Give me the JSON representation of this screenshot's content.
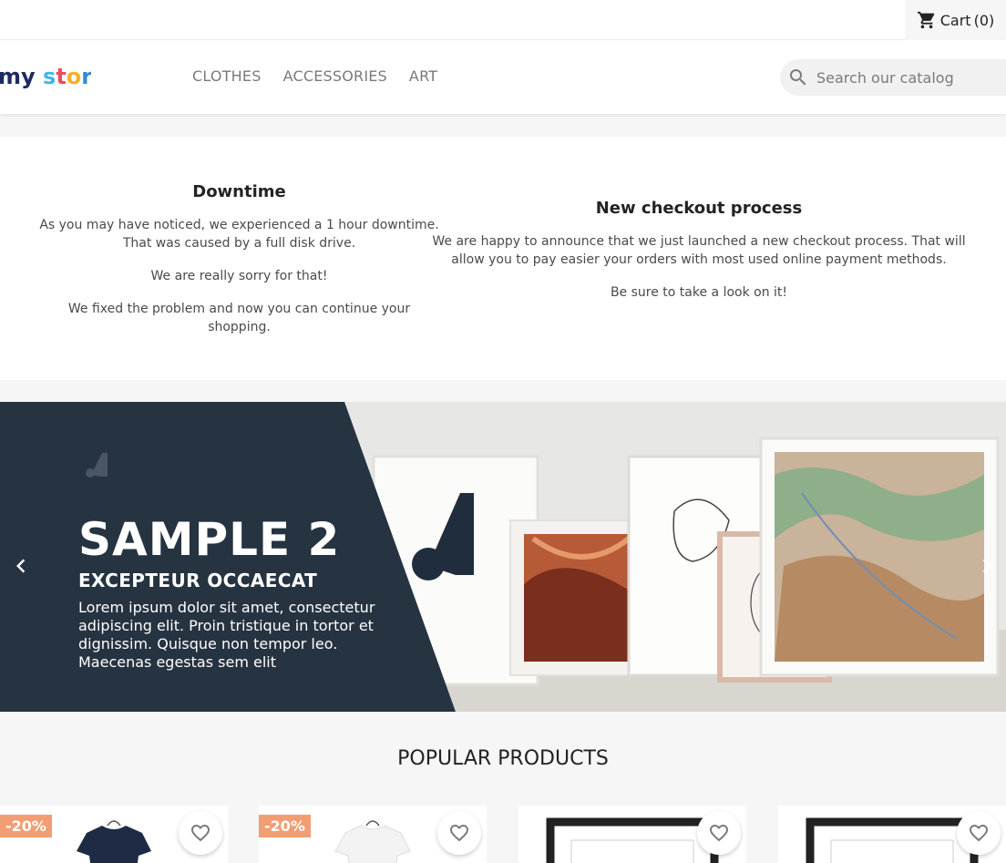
{
  "topbar": {
    "cart_label": "Cart",
    "cart_count": "(0)"
  },
  "header": {
    "logo_alt": "my store",
    "menu": [
      {
        "label": "CLOTHES"
      },
      {
        "label": "ACCESSORIES"
      },
      {
        "label": "ART"
      }
    ],
    "search_placeholder": "Search our catalog"
  },
  "notices": [
    {
      "title": "Downtime",
      "paragraphs": [
        "As you may have noticed, we experienced a 1 hour downtime. That was caused by a full disk drive.",
        "We are really sorry for that!",
        "We fixed the problem and now you can continue your shopping."
      ]
    },
    {
      "title": "New checkout process",
      "paragraphs": [
        "We are happy to announce that we just launched a new checkout process. That will allow you to pay easier your orders with most used online payment methods.",
        "Be sure to take a look on it!"
      ]
    }
  ],
  "slider": {
    "title": "SAMPLE 2",
    "subtitle": "EXCEPTEUR OCCAECAT",
    "description": "Lorem ipsum dolor sit amet, consectetur adipiscing elit. Proin tristique in tortor et dignissim. Quisque non tempor leo. Maecenas egestas sem elit",
    "colors": {
      "panel": "#263341",
      "wall": "#e7e8e5"
    }
  },
  "popular": {
    "title": "POPULAR PRODUCTS",
    "products": [
      {
        "badge": "-20%",
        "kind": "tshirt-dark"
      },
      {
        "badge": "-20%",
        "kind": "tshirt-white"
      },
      {
        "badge": "",
        "kind": "frame"
      },
      {
        "badge": "",
        "kind": "frame"
      }
    ]
  },
  "colors": {
    "accent": "#24b9d7",
    "badge": "#f39d72"
  }
}
